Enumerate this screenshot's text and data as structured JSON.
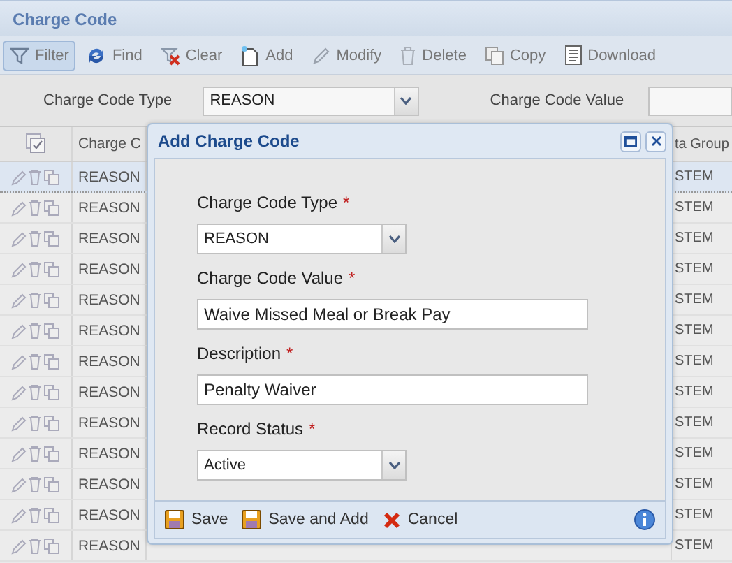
{
  "page_title": "Charge Code",
  "toolbar": [
    {
      "label": "Filter",
      "kind": "filter",
      "selected": true
    },
    {
      "label": "Find",
      "kind": "find",
      "selected": false
    },
    {
      "label": "Clear",
      "kind": "clear",
      "selected": false
    },
    {
      "label": "Add",
      "kind": "add",
      "selected": false
    },
    {
      "label": "Modify",
      "kind": "modify",
      "selected": false
    },
    {
      "label": "Delete",
      "kind": "delete",
      "selected": false
    },
    {
      "label": "Copy",
      "kind": "copy",
      "selected": false
    },
    {
      "label": "Download",
      "kind": "download",
      "selected": false
    }
  ],
  "filter": {
    "type_label": "Charge Code Type",
    "type_value": "REASON",
    "value_label": "Charge Code Value"
  },
  "grid": {
    "columns": [
      "Charge C",
      "ta Group"
    ],
    "rows": [
      {
        "type": "REASON",
        "group": "STEM",
        "selected": true
      },
      {
        "type": "REASON",
        "group": "STEM",
        "selected": false
      },
      {
        "type": "REASON",
        "group": "STEM",
        "selected": false
      },
      {
        "type": "REASON",
        "group": "STEM",
        "selected": false
      },
      {
        "type": "REASON",
        "group": "STEM",
        "selected": false
      },
      {
        "type": "REASON",
        "group": "STEM",
        "selected": false
      },
      {
        "type": "REASON",
        "group": "STEM",
        "selected": false
      },
      {
        "type": "REASON",
        "group": "STEM",
        "selected": false
      },
      {
        "type": "REASON",
        "group": "STEM",
        "selected": false
      },
      {
        "type": "REASON",
        "group": "STEM",
        "selected": false
      },
      {
        "type": "REASON",
        "group": "STEM",
        "selected": false
      },
      {
        "type": "REASON",
        "group": "STEM",
        "selected": false
      },
      {
        "type": "REASON",
        "group": "STEM",
        "selected": false
      }
    ]
  },
  "dialog": {
    "title": "Add Charge Code",
    "fields": [
      {
        "label": "Charge Code Type",
        "mark": "*",
        "kind": "select",
        "value": "REASON"
      },
      {
        "label": "Charge Code Value",
        "mark": "*",
        "kind": "text",
        "value": "Waive Missed Meal or Break Pay"
      },
      {
        "label": "Description",
        "mark": "*",
        "kind": "text",
        "value": "Penalty Waiver"
      },
      {
        "label": "Record Status",
        "mark": "*",
        "kind": "select",
        "value": "Active"
      }
    ],
    "buttons": [
      {
        "label": "Save",
        "kind": "save"
      },
      {
        "label": "Save and Add",
        "kind": "save"
      },
      {
        "label": "Cancel",
        "kind": "cancel"
      }
    ]
  }
}
